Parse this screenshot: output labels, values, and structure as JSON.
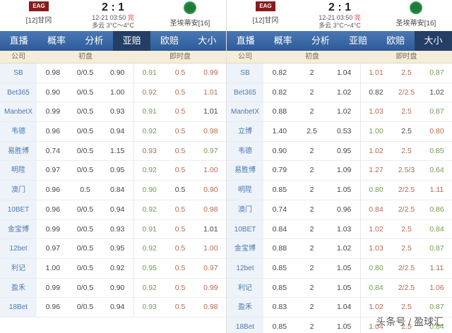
{
  "match": {
    "home": "[12]甘冈",
    "away": "圣埃蒂安[16]",
    "home_logo": "EAG",
    "score": "2 : 1",
    "time": "12-21 03:50",
    "status": "完",
    "weather": "多云 3°C～4°C"
  },
  "tabs": [
    "直播",
    "概率",
    "分析",
    "亚赔",
    "欧赔",
    "大小"
  ],
  "colors": {
    "nav": "#2f5c97",
    "active": "#243f66",
    "up": "#b46a4e",
    "down": "#6e9e4c"
  },
  "panels": [
    {
      "active_tab": 3,
      "headers": [
        "公司",
        "初盘",
        "即时盘"
      ],
      "rows": [
        [
          "SB",
          "0.98",
          "0/0.5",
          "0.90",
          "0.91",
          "0.5",
          "0.99",
          "grr"
        ],
        [
          "Bet365",
          "0.90",
          "0/0.5",
          "1.00",
          "0.92",
          "0.5",
          "1.01",
          "rrr"
        ],
        [
          "ManbetX",
          "0.99",
          "0/0.5",
          "0.93",
          "0.91",
          "0.5",
          "1.01",
          "grn"
        ],
        [
          "韦德",
          "0.96",
          "0/0.5",
          "0.94",
          "0.92",
          "0.5",
          "0.98",
          "grr"
        ],
        [
          "易胜博",
          "0.74",
          "0/0.5",
          "1.15",
          "0.93",
          "0.5",
          "0.97",
          "rrg"
        ],
        [
          "明陞",
          "0.97",
          "0/0.5",
          "0.95",
          "0.92",
          "0.5",
          "1.00",
          "grr"
        ],
        [
          "澳门",
          "0.96",
          "0.5",
          "0.84",
          "0.90",
          "0.5",
          "0.90",
          "gnr"
        ],
        [
          "10BET",
          "0.96",
          "0/0.5",
          "0.94",
          "0.92",
          "0.5",
          "0.98",
          "grr"
        ],
        [
          "金宝博",
          "0.99",
          "0/0.5",
          "0.93",
          "0.91",
          "0.5",
          "1.01",
          "grn"
        ],
        [
          "12bet",
          "0.97",
          "0/0.5",
          "0.95",
          "0.92",
          "0.5",
          "1.00",
          "grr"
        ],
        [
          "利记",
          "1.00",
          "0/0.5",
          "0.92",
          "0.95",
          "0.5",
          "0.97",
          "grr"
        ],
        [
          "盈禾",
          "0.99",
          "0/0.5",
          "0.90",
          "0.92",
          "0.5",
          "0.99",
          "grr"
        ],
        [
          "18Bet",
          "0.96",
          "0/0.5",
          "0.94",
          "0.93",
          "0.5",
          "0.98",
          "grr"
        ]
      ]
    },
    {
      "active_tab": 5,
      "headers": [
        "公司",
        "初盘",
        "即时盘"
      ],
      "rows": [
        [
          "SB",
          "0.82",
          "2",
          "1.04",
          "1.01",
          "2.5",
          "0.87",
          "rrg"
        ],
        [
          "Bet365",
          "0.82",
          "2",
          "1.02",
          "0.82",
          "2/2.5",
          "1.02",
          "nrn"
        ],
        [
          "ManbetX",
          "0.88",
          "2",
          "1.02",
          "1.03",
          "2.5",
          "0.87",
          "rrg"
        ],
        [
          "立博",
          "1.40",
          "2.5",
          "0.53",
          "1.00",
          "2.5",
          "0.80",
          "gnr"
        ],
        [
          "韦德",
          "0.90",
          "2",
          "0.95",
          "1.02",
          "2.5",
          "0.85",
          "rrg"
        ],
        [
          "易胜博",
          "0.79",
          "2",
          "1.09",
          "1.27",
          "2.5/3",
          "0.64",
          "rrg"
        ],
        [
          "明陞",
          "0.85",
          "2",
          "1.05",
          "0.80",
          "2/2.5",
          "1.11",
          "grr"
        ],
        [
          "澳门",
          "0.74",
          "2",
          "0.96",
          "0.84",
          "2/2.5",
          "0.86",
          "rrg"
        ],
        [
          "10BET",
          "0.84",
          "2",
          "1.03",
          "1.02",
          "2.5",
          "0.84",
          "rrg"
        ],
        [
          "金宝博",
          "0.88",
          "2",
          "1.02",
          "1.03",
          "2.5",
          "0.87",
          "rrg"
        ],
        [
          "12bet",
          "0.85",
          "2",
          "1.05",
          "0.80",
          "2/2.5",
          "1.11",
          "grr"
        ],
        [
          "利记",
          "0.85",
          "2",
          "1.05",
          "0.84",
          "2/2.5",
          "1.06",
          "grr"
        ],
        [
          "盈禾",
          "0.83",
          "2",
          "1.04",
          "1.02",
          "2.5",
          "0.87",
          "rrg"
        ],
        [
          "18Bet",
          "0.85",
          "2",
          "1.05",
          "1.04",
          "2.5",
          "0.84",
          "rrg"
        ]
      ]
    }
  ],
  "watermark": "头条号 / 盈球汇"
}
